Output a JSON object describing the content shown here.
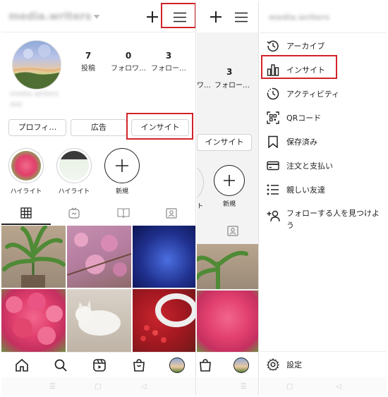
{
  "left": {
    "username": "media.writers",
    "stats": [
      {
        "num": "7",
        "label": "投稿"
      },
      {
        "num": "0",
        "label": "フォロワ…"
      },
      {
        "num": "3",
        "label": "フォロー…"
      }
    ],
    "bio_line1": "media writers",
    "bio_line2": "444",
    "buttons": {
      "profile": "プロフィ…",
      "ads": "広告",
      "insights": "インサイト"
    },
    "highlights": [
      {
        "label": "ハイライト"
      },
      {
        "label": "ハイライト"
      },
      {
        "label": "新規"
      }
    ]
  },
  "middle": {
    "stat_num": "3",
    "stat_labels": [
      "ワ…",
      "フォロー…"
    ],
    "insights_button": "インサイト",
    "highlight_label_partial": "ト",
    "new_label": "新規"
  },
  "menu": {
    "title": "media.writers",
    "items": [
      {
        "icon": "archive-icon",
        "label": "アーカイブ"
      },
      {
        "icon": "insights-icon",
        "label": "インサイト"
      },
      {
        "icon": "activity-icon",
        "label": "アクティビティ"
      },
      {
        "icon": "qr-code-icon",
        "label": "QRコード"
      },
      {
        "icon": "bookmark-icon",
        "label": "保存済み"
      },
      {
        "icon": "card-icon",
        "label": "注文と支払い"
      },
      {
        "icon": "close-friends-icon",
        "label": "親しい友達"
      },
      {
        "icon": "add-person-icon",
        "label": "フォローする人を見つけよう"
      }
    ],
    "settings": "設定"
  },
  "colors": {
    "highlight_box": "#d2232a",
    "accent_text": "#222222",
    "divider": "#ececec"
  }
}
